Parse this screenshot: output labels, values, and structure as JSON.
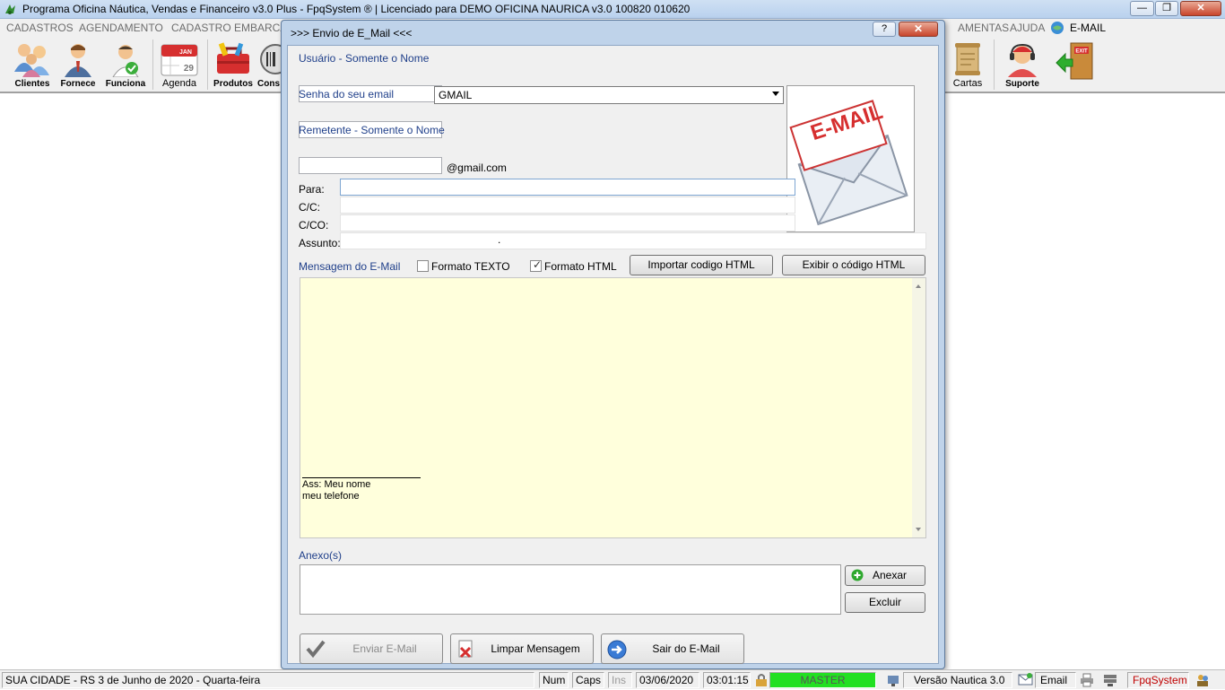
{
  "window": {
    "title": "Programa Oficina Náutica, Vendas e Financeiro v3.0 Plus - FpqSystem ® | Licenciado para  DEMO OFICINA NAURICA v3.0 100820 010620",
    "minimize": "—",
    "maximize": "❐",
    "close": "✕"
  },
  "menu": {
    "items": [
      "CADASTROS",
      "AGENDAMENTO",
      "CADASTRO EMBARCA",
      "AMENTAS",
      "AJUDA",
      "E-MAIL"
    ]
  },
  "toolbar": {
    "clientes": "Clientes",
    "fornece": "Fornece",
    "funciona": "Funciona",
    "agenda": "Agenda",
    "agenda_month": "JAN",
    "agenda_day": "29",
    "produtos": "Produtos",
    "cons": "Cons",
    "cartas": "Cartas",
    "suporte": "Suporte",
    "exit_sign": "EXIT"
  },
  "dialog": {
    "title": ">>> Envio de E_Mail <<<",
    "help": "?",
    "close": "✕",
    "usuario_label": "Usuário - Somente o Nome",
    "usuario_value": "",
    "server_selected": "GMAIL",
    "senha_label": "Senha do seu email",
    "senha_value": "",
    "remetente_label": "Remetente - Somente o Nome",
    "remetente_value": "",
    "domain_suffix": "@gmail.com",
    "para_label": "Para:",
    "cc_label": "C/C:",
    "cco_label": "C/CO:",
    "assunto_label": "Assunto:",
    "assunto_value": ".",
    "logo_text": "E-MAIL",
    "mensagem_label": "Mensagem do E-Mail",
    "formato_texto": "Formato TEXTO",
    "formato_texto_checked": false,
    "formato_html": "Formato HTML",
    "formato_html_checked": true,
    "importar_btn": "Importar codigo HTML",
    "exibir_btn": "Exibir o código HTML",
    "signature_line1": "Ass: Meu  nome",
    "signature_line2": "meu telefone",
    "anexos_label": "Anexo(s)",
    "anexar_btn": "Anexar",
    "excluir_btn": "Excluir",
    "enviar_btn": "Enviar E-Mail",
    "limpar_btn": "Limpar Mensagem",
    "sair_btn": "Sair do E-Mail"
  },
  "statusbar": {
    "city": "SUA CIDADE - RS  3 de Junho de 2020 - Quarta-feira",
    "num": "Num",
    "caps": "Caps",
    "ins": "Ins",
    "date": "03/06/2020",
    "time": "03:01:15",
    "user": "MASTER",
    "version": "Versão Nautica 3.0",
    "email": "Email",
    "brand": "FpqSystem"
  },
  "colors": {
    "dialog_frame": "#bfd3ea",
    "message_bg": "#ffffdc",
    "label_blue": "#1f3f8a",
    "status_master": "#22e022",
    "brand_red": "#c00000"
  }
}
